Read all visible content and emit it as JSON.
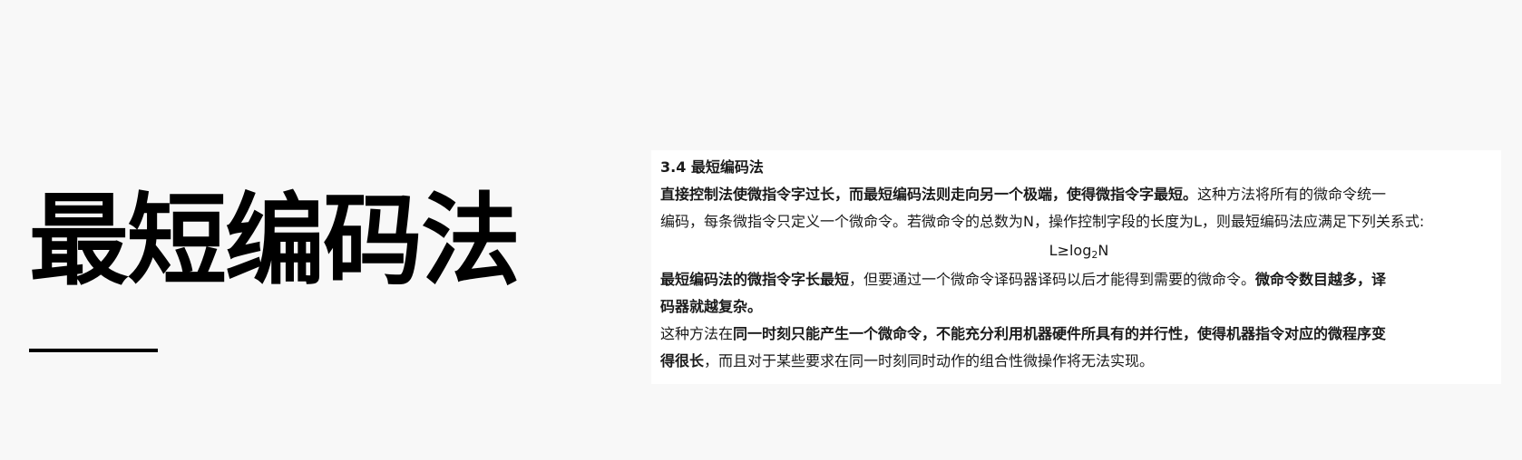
{
  "slide": {
    "title": "最短编码法"
  },
  "document": {
    "heading": "3.4 最短编码法",
    "para1": {
      "line1_bold": "直接控制法使微指令字过长，而最短编码法则走向另一个极端，使得微指令字最短。",
      "line1_rest": "这种方法将所有的微命令统一",
      "line2": "编码，每条微指令只定义一个微命令。若微命令的总数为N，操作控制字段的长度为L，则最短编码法应满足下列关系式:"
    },
    "formula": {
      "lhs": "L≥log",
      "base": "2",
      "arg": "N"
    },
    "para2": {
      "line1_bold": "最短编码法的微指令字长最短",
      "line1_mid": "，但要通过一个微命令译码器译码以后才能得到需要的微命令。",
      "line1_bold2": "微命令数目越多，译",
      "line2_bold": "码器就越复杂。"
    },
    "para3": {
      "line1_a": "这种方法在",
      "line1_bold": "同一时刻只能产生一个微命令，不能充分利用机器硬件所具有的并行性，使得机器指令对应的微程序变",
      "line2_bold": "得很长",
      "line2_rest": "，而且对于某些要求在同一时刻同时动作的组合性微操作将无法实现。"
    }
  }
}
